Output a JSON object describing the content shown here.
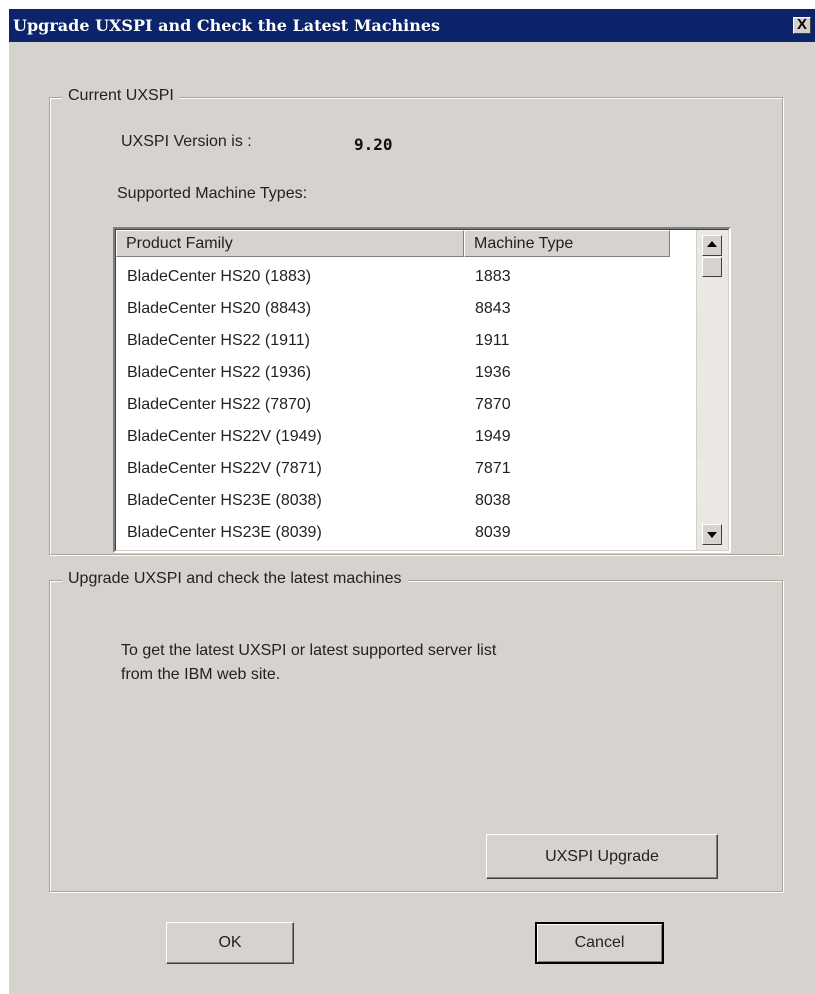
{
  "window": {
    "title": "Upgrade UXSPI and Check the Latest Machines",
    "close_glyph": "X"
  },
  "current_group": {
    "legend": "Current UXSPI",
    "version_label": "UXSPI Version is :",
    "version_value": "9.20",
    "supported_label": "Supported Machine Types:",
    "columns": [
      "Product Family",
      "Machine Type"
    ],
    "rows": [
      [
        "BladeCenter HS20 (1883)",
        "1883"
      ],
      [
        "BladeCenter HS20 (8843)",
        "8843"
      ],
      [
        "BladeCenter HS22 (1911)",
        "1911"
      ],
      [
        "BladeCenter HS22 (1936)",
        "1936"
      ],
      [
        "BladeCenter HS22 (7870)",
        "7870"
      ],
      [
        "BladeCenter HS22V (1949)",
        "1949"
      ],
      [
        "BladeCenter HS22V (7871)",
        "7871"
      ],
      [
        "BladeCenter HS23E (8038)",
        "8038"
      ],
      [
        "BladeCenter HS23E (8039)",
        "8039"
      ]
    ]
  },
  "upgrade_group": {
    "legend": "Upgrade UXSPI and check the latest machines",
    "info_line1": "To get the latest UXSPI or latest supported server list",
    "info_line2": "from the IBM web site.",
    "upgrade_button": "UXSPI Upgrade"
  },
  "buttons": {
    "ok": "OK",
    "cancel": "Cancel"
  },
  "icons": {
    "scroll_up": "scroll-up-arrow-icon",
    "scroll_down": "scroll-down-arrow-icon",
    "close": "close-icon"
  },
  "colors": {
    "titlebar": "#0b246b",
    "dialog_bg": "#d6d3ce"
  }
}
